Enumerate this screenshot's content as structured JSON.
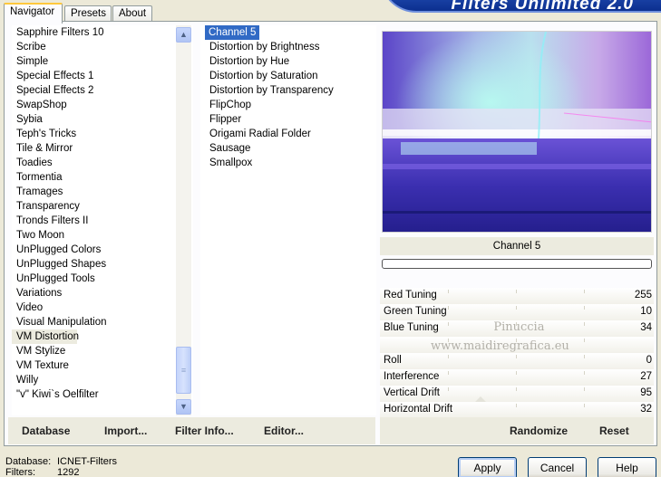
{
  "tabs": [
    "Navigator",
    "Presets",
    "About"
  ],
  "banner_title": "Filters Unlimited 2.0",
  "categories": [
    "Sapphire Filters 10",
    "Scribe",
    "Simple",
    "Special Effects 1",
    "Special Effects 2",
    "SwapShop",
    "Sybia",
    "Teph's Tricks",
    "Tile & Mirror",
    "Toadies",
    "Tormentia",
    "Tramages",
    "Transparency",
    "Tronds Filters II",
    "Two Moon",
    "UnPlugged Colors",
    "UnPlugged Shapes",
    "UnPlugged Tools",
    "Variations",
    "Video",
    "Visual Manipulation",
    "VM Distortion",
    "VM Stylize",
    "VM Texture",
    "Willy",
    "\"v\" Kiwi`s Oelfilter"
  ],
  "selected_category": "VM Distortion",
  "filters": [
    "Channel 5",
    "Distortion by Brightness",
    "Distortion by Hue",
    "Distortion by Saturation",
    "Distortion by Transparency",
    "FlipChop",
    "Flipper",
    "Origami Radial Folder",
    "Sausage",
    "Smallpox"
  ],
  "selected_filter": "Channel 5",
  "preview_filter_name": "Channel 5",
  "progress": 0,
  "sliders": [
    {
      "label": "Red Tuning",
      "value": "255"
    },
    {
      "label": "Green Tuning",
      "value": "10"
    },
    {
      "label": "Blue Tuning",
      "value": "34"
    },
    {
      "label": "",
      "value": ""
    },
    {
      "label": "Roll",
      "value": "0"
    },
    {
      "label": "Interference",
      "value": "27"
    },
    {
      "label": "Vertical Drift",
      "value": "95"
    },
    {
      "label": "Horizontal Drift",
      "value": "32"
    }
  ],
  "watermark_line1": "Pinuccia",
  "watermark_line2": "www.maidiregrafica.eu",
  "left_buttons": {
    "database": "Database",
    "import": "Import...",
    "filter_info": "Filter Info...",
    "editor": "Editor..."
  },
  "right_buttons": {
    "randomize": "Randomize",
    "reset": "Reset"
  },
  "footer": {
    "database_label": "Database:",
    "database_value": "ICNET-Filters",
    "filters_label": "Filters:",
    "filters_value": "1292"
  },
  "dialog_buttons": {
    "apply": "Apply",
    "cancel": "Cancel",
    "help": "Help"
  },
  "icons": {
    "scroll_up": "chevron-up-icon",
    "scroll_down": "chevron-down-icon",
    "grip": "grip-icon"
  }
}
